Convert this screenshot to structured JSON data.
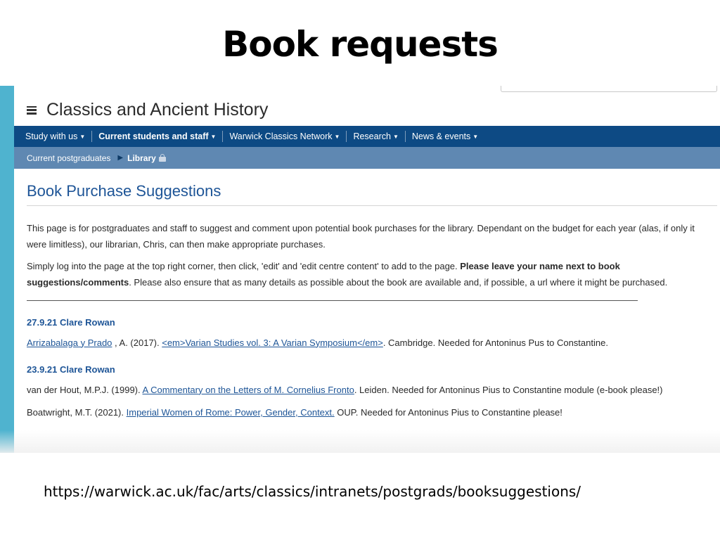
{
  "slide": {
    "title": "Book requests",
    "url": "https://warwick.ac.uk/fac/arts/classics/intranets/postgrads/booksuggestions/"
  },
  "site": {
    "title": "Classics and Ancient History"
  },
  "nav": {
    "items": [
      {
        "label": "Study with us",
        "active": false
      },
      {
        "label": "Current students and staff",
        "active": true
      },
      {
        "label": "Warwick Classics Network",
        "active": false
      },
      {
        "label": "Research",
        "active": false
      },
      {
        "label": "News & events",
        "active": false
      }
    ]
  },
  "breadcrumb": {
    "parent": "Current postgraduates",
    "current": "Library"
  },
  "page": {
    "title": "Book Purchase Suggestions",
    "intro": "This page is for postgraduates and staff to suggest and comment upon potential book purchases for the library. Dependant on the budget for each year (alas, if only it were limitless), our librarian, Chris, can then make appropriate purchases.",
    "instructions_pre": "Simply log into the page at the top right corner, then click, 'edit' and 'edit centre content' to add to the page. ",
    "instructions_bold": "Please leave your name next to book suggestions/comments",
    "instructions_post": ". Please also ensure that as many details as possible about the book are available and, if possible, a url where it might be purchased."
  },
  "entries": [
    {
      "heading": "27.9.21 Clare Rowan",
      "items": [
        {
          "pre": "",
          "link1": "Arrizabalaga y Prado",
          "mid": " , A. (2017). ",
          "link2": "<em>Varian Studies vol. 3: A Varian Symposium</em>",
          "post": ". Cambridge. Needed for Antoninus Pus to Constantine."
        }
      ]
    },
    {
      "heading": "23.9.21 Clare Rowan",
      "items": [
        {
          "pre": "van der Hout, M.P.J. (1999). ",
          "link": "A Commentary on the Letters of M. Cornelius Fronto",
          "post": ". Leiden. Needed for Antoninus Pius to Constantine module (e-book please!)"
        },
        {
          "pre": "Boatwright, M.T. (2021). ",
          "link": "Imperial Women of Rome: Power, Gender, Context.",
          "post": " OUP. Needed for Antoninus Pius to Constantine please!"
        }
      ]
    }
  ]
}
